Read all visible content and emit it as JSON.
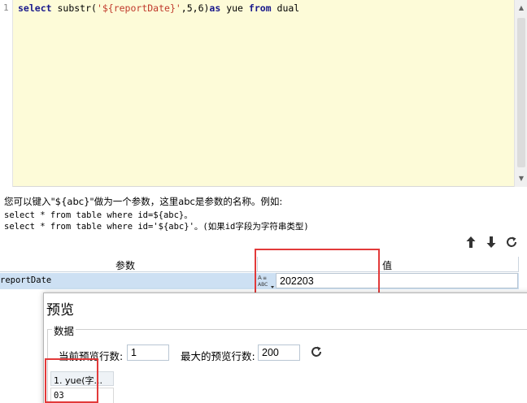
{
  "editor": {
    "line_number": "1",
    "sql": {
      "kw_select": "select",
      "fn_open": " substr(",
      "string_arg": "'${reportDate}'",
      "args_rest": ",5,6)",
      "kw_as": "as",
      "alias": " yue ",
      "kw_from": "from",
      "table": " dual"
    }
  },
  "hint": {
    "line1": "您可以键入\"${abc}\"做为一个参数，这里abc是参数的名称。例如:",
    "line2": "select * from table where id=${abc}。",
    "line3": "select * from table where id='${abc}'。(如果id字段为字符串类型)"
  },
  "toolbar": {
    "move_up_icon": "arrow-up-icon",
    "move_down_icon": "arrow-down-icon",
    "refresh_icon": "refresh-icon"
  },
  "params_table": {
    "header_param": "参数",
    "header_value": "值",
    "rows": [
      {
        "name": "reportDate",
        "type_icon": "text-type-icon",
        "value": "202203"
      }
    ]
  },
  "preview": {
    "title": "预览",
    "group_label": "数据",
    "current_rows_label": "当前预览行数:",
    "current_rows_value": "1",
    "max_rows_label": "最大的预览行数:",
    "max_rows_value": "200",
    "grid": {
      "column_header": "1. yue(字...",
      "cell_value": "03"
    }
  },
  "colors": {
    "editor_background": "#fdfbd8",
    "selected_row": "#cde0f3",
    "annotation_red": "#e23a3a",
    "sql_keyword": "#1a1a8c",
    "sql_string": "#c0392b"
  }
}
